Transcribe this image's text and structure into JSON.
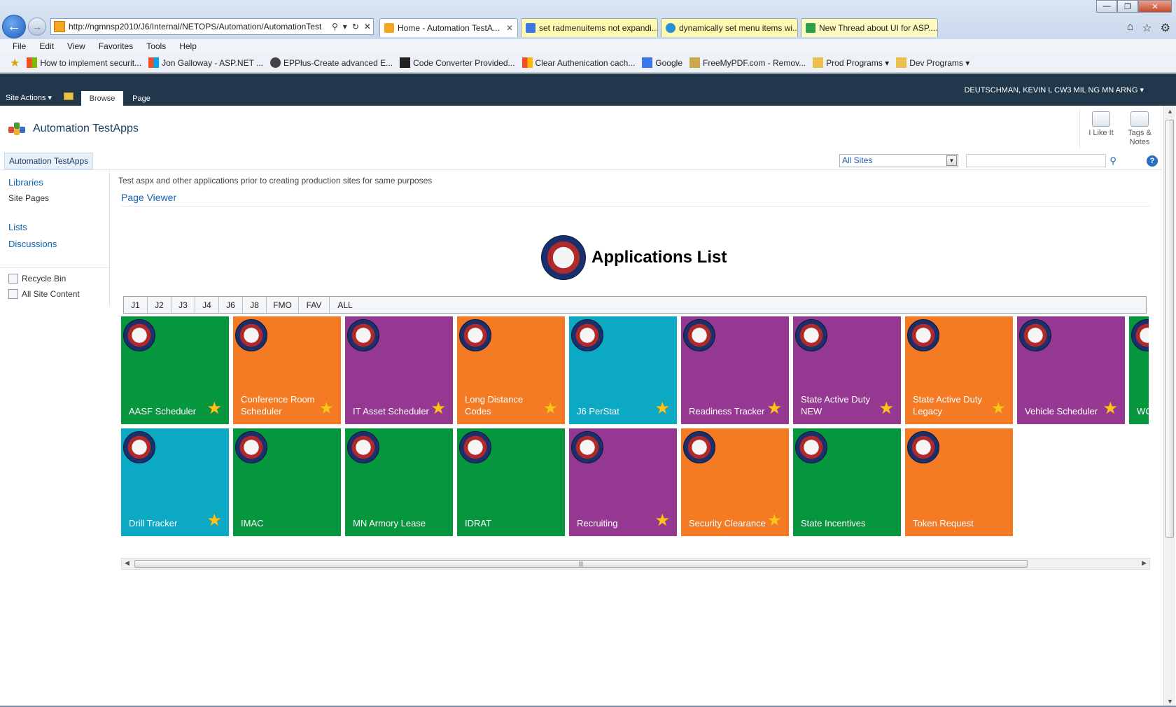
{
  "browser": {
    "address_url": "http://ngmnsp2010/J6/Internal/NETOPS/Automation/AutomationTest",
    "tabs": [
      {
        "label": "Home - Automation TestA...",
        "active": true
      },
      {
        "label": "set radmenuitems not expandi..."
      },
      {
        "label": "dynamically set menu items wi..."
      },
      {
        "label": "New Thread about UI for ASP...."
      }
    ],
    "menu": [
      "File",
      "Edit",
      "View",
      "Favorites",
      "Tools",
      "Help"
    ],
    "favorites": [
      "How to implement securit...",
      "Jon Galloway - ASP.NET ...",
      "EPPlus-Create advanced E...",
      "Code Converter  Provided...",
      "Clear Authenication cach...",
      "Google",
      "FreeMyPDF.com - Remov...",
      "Prod Programs ▾",
      "Dev Programs ▾"
    ]
  },
  "ribbon": {
    "site_actions": "Site Actions ▾",
    "tabs": [
      "Browse",
      "Page"
    ],
    "user": "DEUTSCHMAN, KEVIN L CW3 MIL NG MN ARNG ▾"
  },
  "site": {
    "title": "Automation TestApps",
    "social": {
      "like": "I Like It",
      "tags": [
        "Tags &",
        "Notes"
      ]
    },
    "topnav": "Automation TestApps",
    "search_scope": "All Sites"
  },
  "quicklaunch": {
    "libraries": "Libraries",
    "site_pages": "Site Pages",
    "lists": "Lists",
    "discussions": "Discussions",
    "recycle_bin": "Recycle Bin",
    "all_site_content": "All Site Content"
  },
  "main": {
    "description": "Test aspx and other applications prior to creating production sites for same purposes",
    "webpart_title": "Page Viewer",
    "apps_title": "Applications List",
    "filters": [
      "J1",
      "J2",
      "J3",
      "J4",
      "J6",
      "J8",
      "FMO",
      "FAV",
      "ALL"
    ]
  },
  "colors": {
    "green": "#05963e",
    "orange": "#f47a24",
    "purple": "#953891",
    "teal": "#0ba9c4",
    "ribbon": "#21374c",
    "link": "#0f63b0"
  },
  "tiles": [
    {
      "label": "AASF Scheduler",
      "color": "green",
      "star": true
    },
    {
      "label": "Conference Room Scheduler",
      "color": "orange",
      "star": true
    },
    {
      "label": "IT Asset Scheduler",
      "color": "purple",
      "star": true
    },
    {
      "label": "Long Distance Codes",
      "color": "orange",
      "star": true
    },
    {
      "label": "J6 PerStat",
      "color": "teal",
      "star": true
    },
    {
      "label": "Readiness Tracker",
      "color": "purple",
      "star": true
    },
    {
      "label": "State Active Duty NEW",
      "color": "purple",
      "star": true
    },
    {
      "label": "State Active Duty Legacy",
      "color": "orange",
      "star": true
    },
    {
      "label": "Vehicle Scheduler",
      "color": "purple",
      "star": true
    },
    {
      "label": "WO",
      "color": "green",
      "star": false
    },
    {
      "label": "Drill Tracker",
      "color": "teal",
      "star": true
    },
    {
      "label": "IMAC",
      "color": "green",
      "star": false
    },
    {
      "label": "MN Armory Lease",
      "color": "green",
      "star": false
    },
    {
      "label": "IDRAT",
      "color": "green",
      "star": false
    },
    {
      "label": "Recruiting",
      "color": "purple",
      "star": true
    },
    {
      "label": "Security Clearance",
      "color": "orange",
      "star": true
    },
    {
      "label": "State Incentives",
      "color": "green",
      "star": false
    },
    {
      "label": "Token Request",
      "color": "orange",
      "star": false
    }
  ]
}
